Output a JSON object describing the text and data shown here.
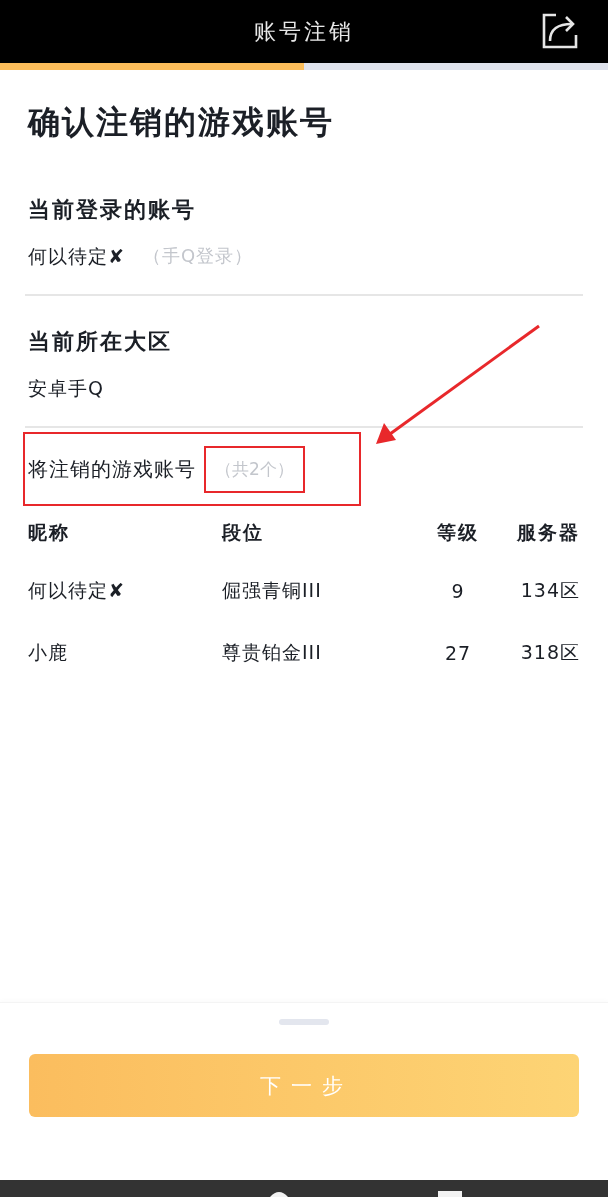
{
  "header": {
    "title": "账号注销"
  },
  "progress": {
    "level": 0.5
  },
  "page_title": "确认注销的游戏账号",
  "sections": [
    {
      "heading": "当前登录的账号",
      "value": "何以待定✘",
      "note": "（手Q登录）"
    },
    {
      "heading": "当前所在大区",
      "value": "安卓手Q"
    }
  ],
  "accounts": {
    "label": "将注销的游戏账号",
    "count": "（共2个）",
    "columns": [
      "昵称",
      "段位",
      "等级",
      "服务器"
    ],
    "rows": [
      [
        "何以待定✘",
        "倔强青铜III",
        "9",
        "134区"
      ],
      [
        "小鹿",
        "尊贵铂金III",
        "27",
        "318区"
      ]
    ]
  },
  "button": {
    "label": "下一步"
  }
}
